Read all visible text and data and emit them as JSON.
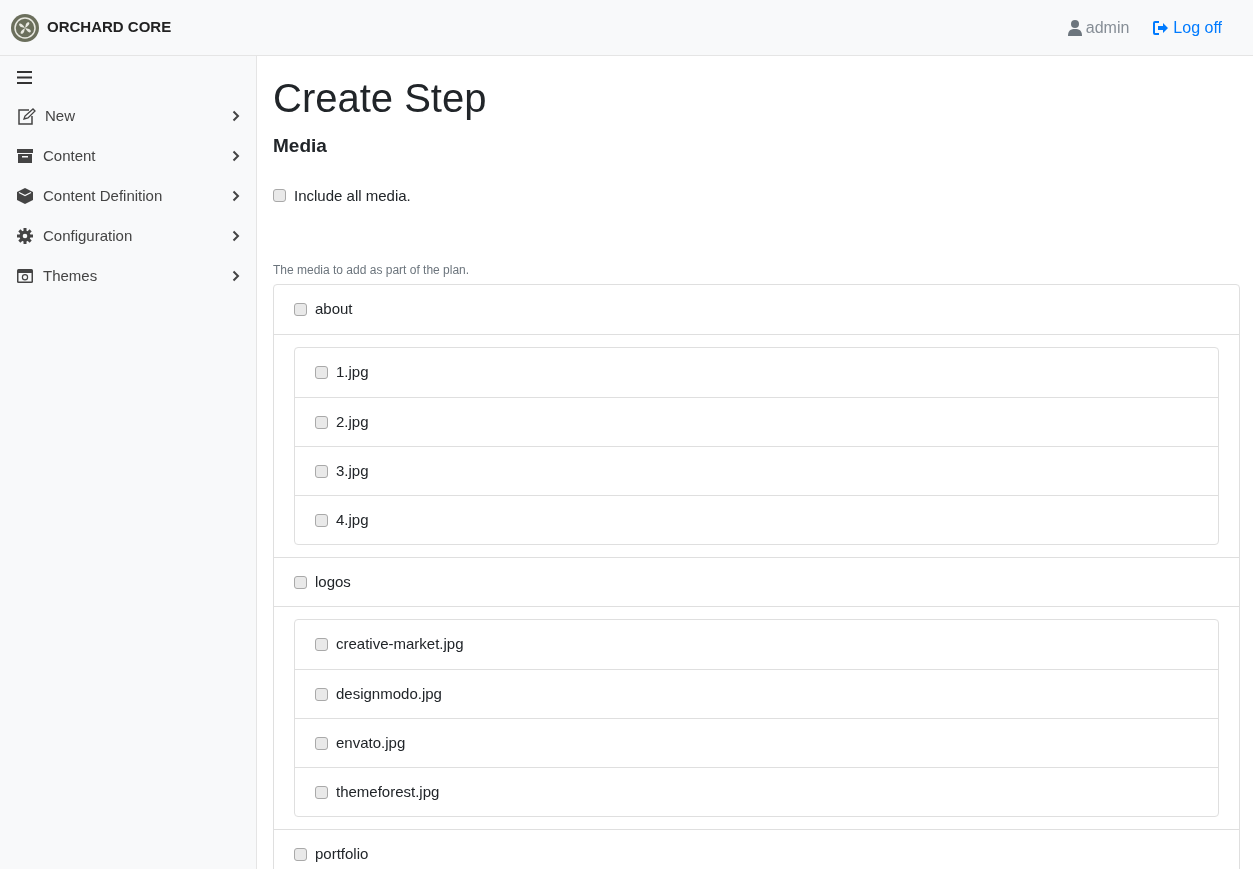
{
  "brand": {
    "title": "ORCHARD CORE"
  },
  "user": {
    "name": "admin",
    "logoff": "Log off"
  },
  "sidebar": {
    "items": [
      {
        "label": "New"
      },
      {
        "label": "Content"
      },
      {
        "label": "Content Definition"
      },
      {
        "label": "Configuration"
      },
      {
        "label": "Themes"
      }
    ]
  },
  "page": {
    "title": "Create Step",
    "subtitle": "Media"
  },
  "include_all": {
    "label": "Include all media.",
    "checked": false
  },
  "hint": "The media to add as part of the plan.",
  "folders": [
    {
      "name": "about",
      "checked": false,
      "children": [
        {
          "name": "1.jpg",
          "checked": false
        },
        {
          "name": "2.jpg",
          "checked": false
        },
        {
          "name": "3.jpg",
          "checked": false
        },
        {
          "name": "4.jpg",
          "checked": false
        }
      ]
    },
    {
      "name": "logos",
      "checked": false,
      "children": [
        {
          "name": "creative-market.jpg",
          "checked": false
        },
        {
          "name": "designmodo.jpg",
          "checked": false
        },
        {
          "name": "envato.jpg",
          "checked": false
        },
        {
          "name": "themeforest.jpg",
          "checked": false
        }
      ]
    },
    {
      "name": "portfolio",
      "checked": false
    }
  ]
}
